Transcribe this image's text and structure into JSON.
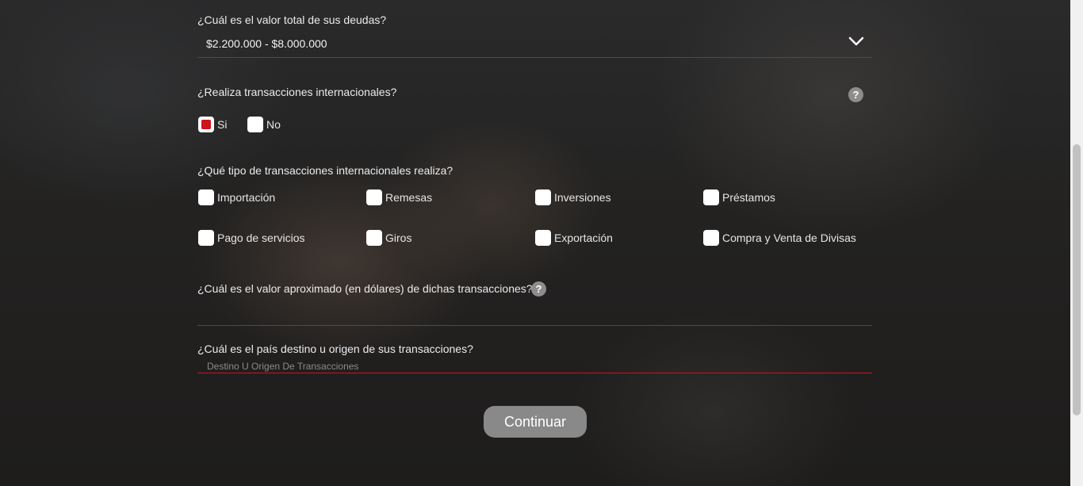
{
  "form": {
    "debts_question": "¿Cuál es el valor total de sus deudas?",
    "debts_value": "$2.200.000 - $8.000.000",
    "intl_question": "¿Realiza transacciones internacionales?",
    "intl_help": "?",
    "intl_options": [
      {
        "label": "Si",
        "checked": true
      },
      {
        "label": "No",
        "checked": false
      }
    ],
    "types_question": "¿Qué tipo de transacciones internacionales realiza?",
    "types": [
      {
        "label": "Importación",
        "checked": false
      },
      {
        "label": "Remesas",
        "checked": false
      },
      {
        "label": "Inversiones",
        "checked": false
      },
      {
        "label": "Préstamos",
        "checked": false
      },
      {
        "label": "Pago de servicios",
        "checked": false
      },
      {
        "label": "Giros",
        "checked": false
      },
      {
        "label": "Exportación",
        "checked": false
      },
      {
        "label": "Compra y Venta de Divisas",
        "checked": false
      }
    ],
    "value_question": "¿Cuál es el valor aproximado (en dólares) de dichas transacciones?",
    "value_help": "?",
    "value_input": "",
    "country_question": "¿Cuál es el país destino u origen de sus transacciones?",
    "country_placeholder": "Destino U Origen De Transacciones",
    "submit_label": "Continuar"
  },
  "colors": {
    "accent": "#d0121b",
    "button": "#898989"
  },
  "icons": {
    "select_arrow": "chevron-down-icon",
    "help": "help-icon"
  }
}
